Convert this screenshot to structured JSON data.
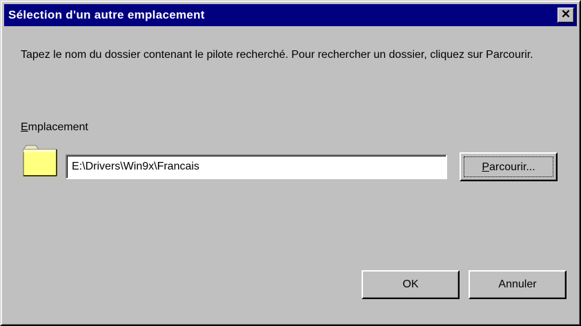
{
  "dialog": {
    "title": "Sélection d'un autre emplacement",
    "close_label": "✕",
    "description": "Tapez le nom du dossier contenant le pilote recherché. Pour rechercher un dossier, cliquez sur Parcourir.",
    "location_label_mnemonic": "E",
    "location_label_rest": "mplacement",
    "location_value": "E:\\Drivers\\Win9x\\Francais",
    "browse_mnemonic": "P",
    "browse_rest": "arcourir...",
    "ok_label": "OK",
    "cancel_label": "Annuler"
  },
  "colors": {
    "titlebar": "#000080",
    "face": "#c0c0c0",
    "folder": "#ffff80"
  },
  "icons": {
    "folder": "folder-icon",
    "close": "close-icon"
  }
}
